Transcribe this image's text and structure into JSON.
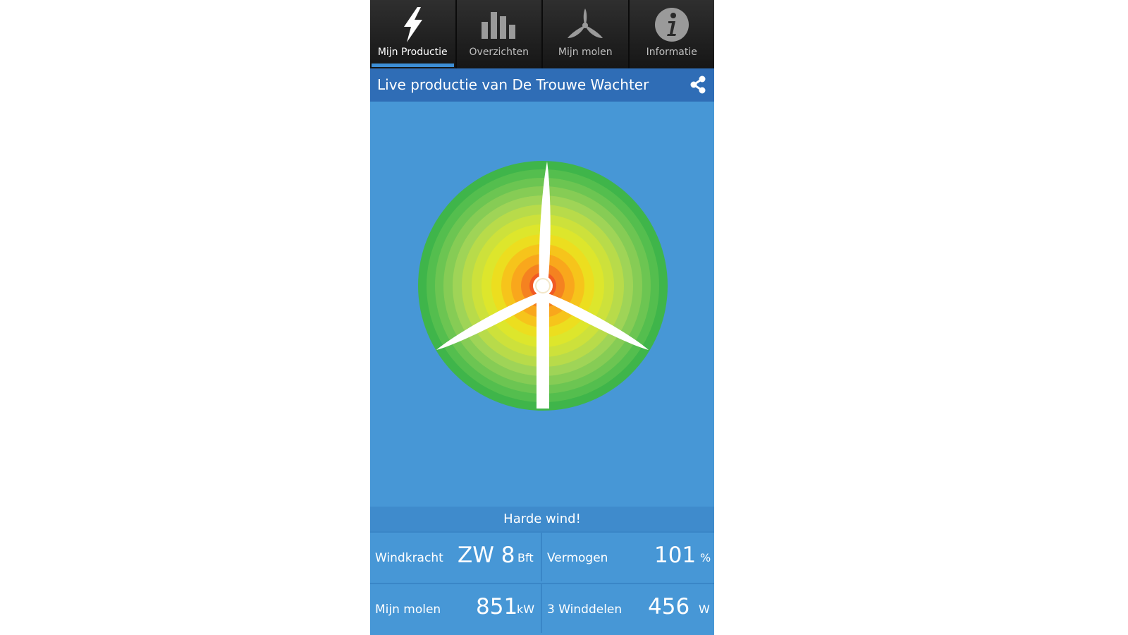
{
  "tabs": [
    {
      "label": "Mijn Productie",
      "icon": "lightning-icon",
      "active": true
    },
    {
      "label": "Overzichten",
      "icon": "bar-chart-icon",
      "active": false
    },
    {
      "label": "Mijn molen",
      "icon": "turbine-icon",
      "active": false
    },
    {
      "label": "Informatie",
      "icon": "info-icon",
      "active": false
    }
  ],
  "header": {
    "title": "Live productie van De Trouwe Wachter",
    "share_icon": "share-icon"
  },
  "status": {
    "text": "Harde wind!"
  },
  "stats": {
    "windkracht": {
      "label": "Windkracht",
      "value": "ZW 8",
      "unit": "Bft"
    },
    "vermogen": {
      "label": "Vermogen",
      "value": "101",
      "unit": "%"
    },
    "mijn_molen": {
      "label": "Mijn molen",
      "value": "851",
      "unit": "kW"
    },
    "winddelen": {
      "label": "3 Winddelen",
      "value": "456",
      "unit": "W"
    }
  },
  "colors": {
    "background": "#4797d6",
    "title_bar": "#2f6db6",
    "tab_active_indicator": "#3d8fd6",
    "ring_outer": "#3fb54a",
    "ring_center": "#f15a24"
  }
}
